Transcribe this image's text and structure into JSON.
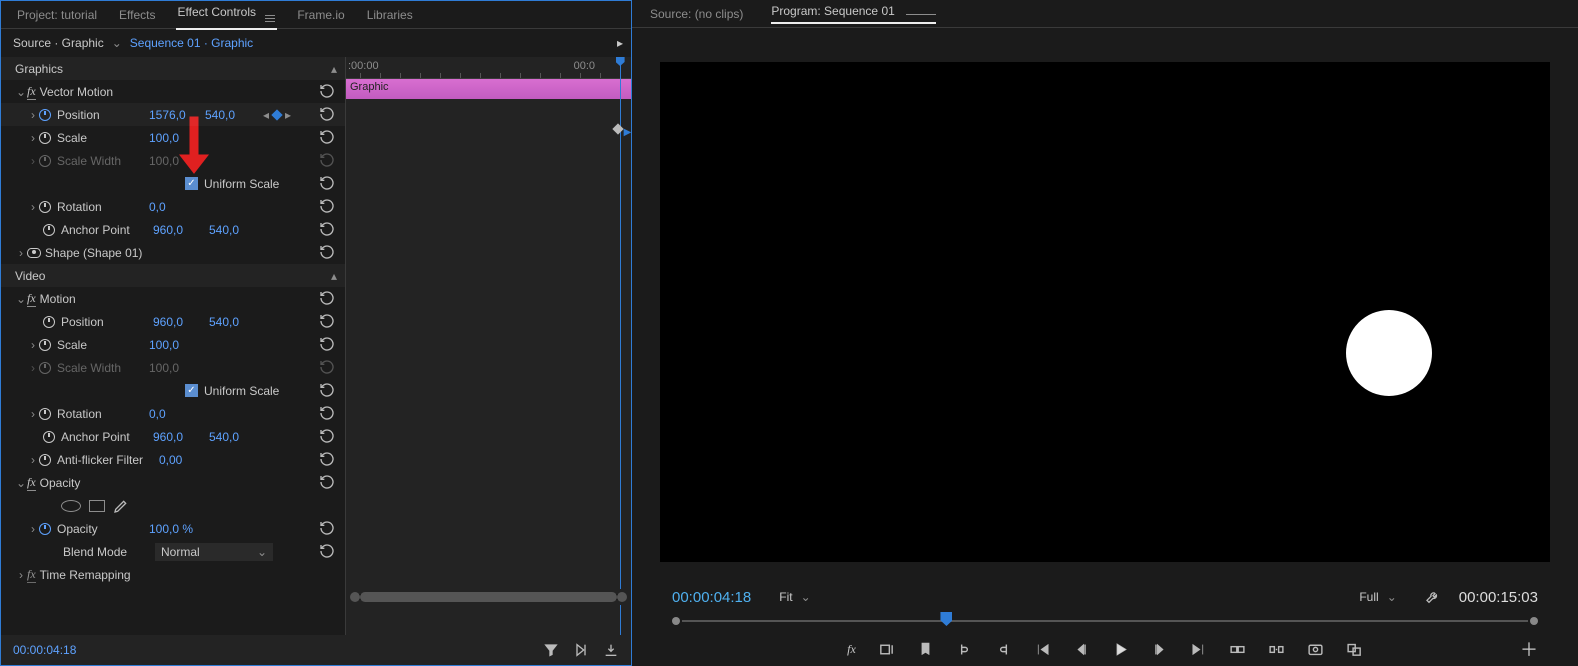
{
  "left": {
    "tabs": {
      "project": "Project: tutorial",
      "effects": "Effects",
      "effect_controls": "Effect Controls",
      "frameio": "Frame.io",
      "libraries": "Libraries"
    },
    "path": {
      "source": "Source · Graphic",
      "sequence": "Sequence 01 · Graphic"
    },
    "ruler": {
      "start": ":00:00",
      "end": "00:0"
    },
    "clip_label": "Graphic",
    "groups": {
      "graphics": "Graphics",
      "video": "Video"
    },
    "vector_motion": {
      "title": "Vector Motion",
      "position": {
        "label": "Position",
        "x": "1576,0",
        "y": "540,0"
      },
      "scale": {
        "label": "Scale",
        "v": "100,0"
      },
      "scale_width": {
        "label": "Scale Width",
        "v": "100,0"
      },
      "uniform": "Uniform Scale",
      "rotation": {
        "label": "Rotation",
        "v": "0,0"
      },
      "anchor": {
        "label": "Anchor Point",
        "x": "960,0",
        "y": "540,0"
      }
    },
    "shape": {
      "title": "Shape (Shape 01)"
    },
    "motion": {
      "title": "Motion",
      "position": {
        "label": "Position",
        "x": "960,0",
        "y": "540,0"
      },
      "scale": {
        "label": "Scale",
        "v": "100,0"
      },
      "scale_width": {
        "label": "Scale Width",
        "v": "100,0"
      },
      "uniform": "Uniform Scale",
      "rotation": {
        "label": "Rotation",
        "v": "0,0"
      },
      "anchor": {
        "label": "Anchor Point",
        "x": "960,0",
        "y": "540,0"
      },
      "antiflicker": {
        "label": "Anti-flicker Filter",
        "v": "0,00"
      }
    },
    "opacity": {
      "title": "Opacity",
      "opacity": {
        "label": "Opacity",
        "v": "100,0 %"
      },
      "blend": {
        "label": "Blend Mode",
        "v": "Normal"
      }
    },
    "time_remap": "Time Remapping",
    "timecode": "00:00:04:18"
  },
  "right": {
    "tabs": {
      "source": "Source: (no clips)",
      "program": "Program: Sequence 01"
    },
    "timecode": "00:00:04:18",
    "fit": "Fit",
    "full": "Full",
    "duration": "00:00:15:03"
  }
}
